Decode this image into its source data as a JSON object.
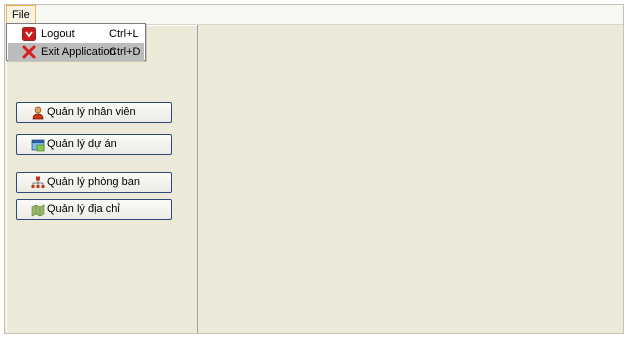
{
  "menu": {
    "file_label": "File",
    "items": [
      {
        "label": "Logout",
        "shortcut": "Ctrl+L",
        "icon": "logout-icon"
      },
      {
        "label": "Exit Application",
        "shortcut": "Ctrl+D",
        "icon": "exit-icon"
      }
    ]
  },
  "nav": {
    "buttons": [
      {
        "label": "Quản lý nhân viên",
        "icon": "employee-icon"
      },
      {
        "label": "Quản lý dự án",
        "icon": "project-icon"
      },
      {
        "label": "Quản lý phòng ban",
        "icon": "department-icon"
      },
      {
        "label": "Quản lý địa chỉ",
        "icon": "address-icon"
      }
    ]
  },
  "colors": {
    "panel_bg": "#ece9d8",
    "button_border": "#2f4a7a",
    "menu_highlight": "#bcbcbc"
  }
}
